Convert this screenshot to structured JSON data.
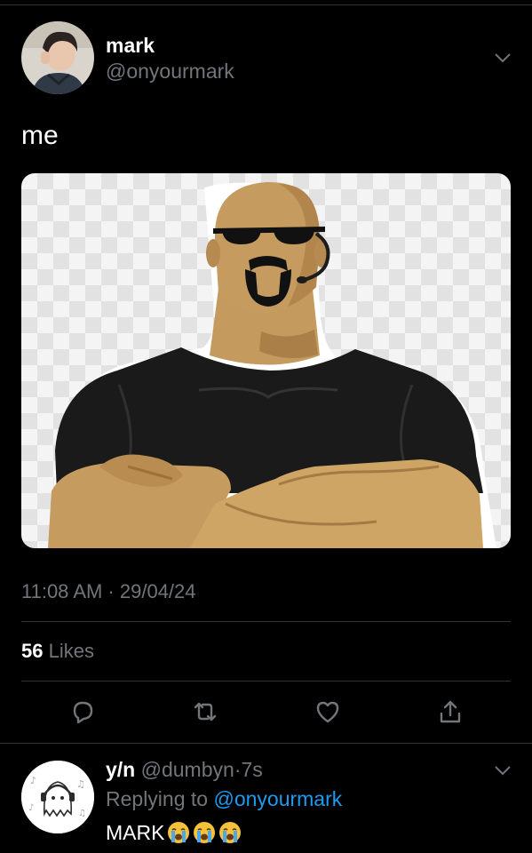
{
  "tweet": {
    "author_name": "mark",
    "author_handle": "@onyourmark",
    "text": "me",
    "timestamp": "11:08 AM · 29/04/24",
    "likes_count": "56",
    "likes_label": "Likes",
    "media_subject": "cartoon bodyguard with sunglasses, headset and crossed arms"
  },
  "actions": {
    "reply_icon": "reply-icon",
    "retweet_icon": "retweet-icon",
    "like_icon": "heart-icon",
    "share_icon": "share-icon"
  },
  "reply": {
    "author_name": "y/n",
    "author_handle": "@dumbyn",
    "separator": "·",
    "age": "7s",
    "replying_prefix": "Replying to ",
    "replying_handle": "@onyourmark",
    "text": "MARK",
    "emoji": [
      "loudly-crying-face",
      "loudly-crying-face",
      "loudly-crying-face"
    ]
  },
  "colors": {
    "background": "#000000",
    "primary_text": "#ffffff",
    "secondary_text": "#71767b",
    "accent": "#1d9bf0",
    "divider": "#2f3336"
  }
}
